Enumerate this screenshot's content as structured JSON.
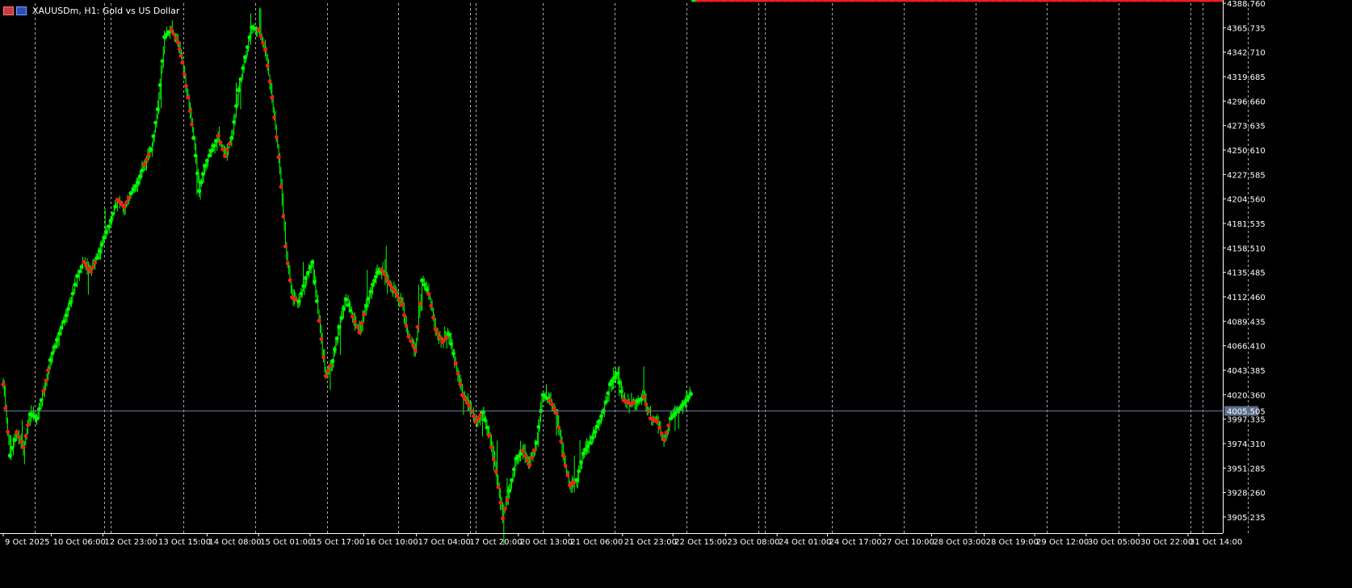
{
  "window": {
    "title": "XAUUSDm, H1:  Gold vs US Dollar",
    "icons": [
      "chart-type-icon",
      "timeframe-icon"
    ]
  },
  "colors": {
    "background": "#000000",
    "bull_candle": "#00ff00",
    "marker_up": "#00ff00",
    "marker_down": "#ff1a1a",
    "grid": "#c8c8c8",
    "axis_text": "#ffffff",
    "current_price_line": "#6a7d95",
    "current_price_label_bg": "#5a6e88"
  },
  "chart_data": {
    "type": "line",
    "symbol": "XAUUSDm",
    "timeframe": "H1",
    "description": "Gold vs US Dollar",
    "current_price": 4005.505,
    "current_price_label": "4005.505",
    "ylim": [
      3890.0,
      4388.76
    ],
    "y_ticks": [
      4388.76,
      4365.735,
      4342.71,
      4319.685,
      4296.66,
      4273.635,
      4250.61,
      4227.585,
      4204.56,
      4181.535,
      4158.51,
      4135.485,
      4112.46,
      4089.435,
      4066.41,
      4043.385,
      4020.36,
      3997.335,
      3974.31,
      3951.285,
      3928.26,
      3905.235
    ],
    "y_tick_labels": [
      "4388.760",
      "4365.735",
      "4342.710",
      "4319.685",
      "4296.660",
      "4273.635",
      "4250.610",
      "4227.585",
      "4204.560",
      "4181.535",
      "4158.510",
      "4135.485",
      "4112.460",
      "4089.435",
      "4066.410",
      "4043.385",
      "4020.360",
      "3997.335",
      "3974.310",
      "3951.285",
      "3928.260",
      "3905.235"
    ],
    "x_labels": [
      "9 Oct 2025",
      "10 Oct 06:00",
      "12 Oct 23:00",
      "13 Oct 15:00",
      "14 Oct 08:00",
      "15 Oct 01:00",
      "15 Oct 17:00",
      "16 Oct 10:00",
      "17 Oct 04:00",
      "17 Oct 20:00",
      "20 Oct 13:00",
      "21 Oct 06:00",
      "21 Oct 23:00",
      "22 Oct 15:00",
      "23 Oct 08:00",
      "24 Oct 01:00",
      "24 Oct 17:00",
      "27 Oct 10:00",
      "28 Oct 03:00",
      "28 Oct 19:00",
      "29 Oct 12:00",
      "30 Oct 05:00",
      "30 Oct 22:00",
      "31 Oct 14:00"
    ],
    "x_label_bars": [
      0,
      43,
      89,
      137,
      182,
      228,
      274,
      322,
      369,
      415,
      460,
      505,
      553,
      598,
      645,
      691,
      736,
      783,
      829,
      876,
      921,
      967,
      1014,
      1058
    ],
    "bar_count": 1089,
    "day_separators": [
      28,
      90,
      96,
      161,
      225,
      289,
      353,
      417,
      422,
      482,
      546,
      610,
      674,
      680,
      740,
      804,
      868,
      932,
      996,
      1060,
      1071,
      1111
    ],
    "series": [
      {
        "bars": [
          0,
          6,
          12,
          18,
          24,
          30,
          36,
          42,
          48,
          54,
          60,
          66,
          72,
          78,
          84,
          90,
          96,
          102,
          108,
          114,
          120,
          126,
          132,
          138,
          144,
          150,
          156,
          160,
          165,
          170,
          175,
          180,
          186,
          192,
          198,
          204,
          210,
          216,
          222,
          228,
          234,
          240,
          246,
          252,
          258,
          264,
          270,
          276,
          282,
          288,
          294,
          300,
          306,
          312,
          318,
          324,
          330,
          334,
          338,
          344,
          350,
          356,
          362,
          368,
          374,
          380,
          386,
          392,
          398,
          404,
          410,
          416,
          422,
          428,
          434,
          440,
          446,
          452,
          458,
          464,
          470,
          476,
          482,
          488,
          494,
          500,
          506,
          512,
          518,
          524,
          530,
          536,
          542,
          548,
          554,
          560,
          566,
          572,
          578,
          584,
          590,
          596,
          602,
          608,
          614,
          620,
          626,
          632,
          638,
          644,
          650,
          656,
          662,
          668,
          674,
          680,
          686,
          692,
          698,
          704,
          710,
          716,
          722,
          728,
          734,
          740,
          746,
          752,
          758,
          764,
          770,
          776,
          782,
          788,
          794,
          800,
          806,
          812,
          818,
          824,
          830,
          836,
          842,
          848,
          854,
          860,
          866,
          872,
          878,
          884,
          890,
          896,
          902,
          908,
          914,
          920,
          926,
          932,
          938,
          944,
          950,
          956,
          962,
          968,
          974,
          980,
          986,
          992,
          998,
          1004,
          1010,
          1016,
          1022,
          1028,
          1034,
          1040,
          1046,
          1052,
          1058,
          1064,
          1070,
          1076,
          1082,
          1088
        ],
        "close": [
          4030,
          3963,
          3985,
          3971,
          4002,
          3998,
          4024,
          4053,
          4072,
          4089,
          4107,
          4132,
          4145,
          4136,
          4149,
          4168,
          4184,
          4204,
          4197,
          4210,
          4220,
          4237,
          4251,
          4289,
          4357,
          4364,
          4352,
          4333,
          4300,
          4262,
          4212,
          4236,
          4250,
          4264,
          4245,
          4262,
          4307,
          4338,
          4366,
          4364,
          4345,
          4300,
          4244,
          4160,
          4112,
          4108,
          4130,
          4145,
          4090,
          4038,
          4052,
          4084,
          4110,
          4094,
          4079,
          4104,
          4124,
          4135,
          4138,
          4126,
          4117,
          4105,
          4075,
          4062,
          4128,
          4115,
          4082,
          4070,
          4077,
          4050,
          4020,
          4010,
          3995,
          4004,
          3982,
          3948,
          3904,
          3930,
          3960,
          3967,
          3954,
          3975,
          4020,
          4015,
          4003,
          3963,
          3935,
          3940,
          3965,
          3975,
          3990,
          4005,
          4030,
          4040,
          4015,
          4012,
          4014,
          4018,
          3998,
          3995,
          3978,
          3998,
          4005,
          4012,
          4021
        ],
        "markers_up": [
          0,
          1,
          0,
          0,
          1,
          1,
          0,
          1,
          1,
          1,
          1,
          1,
          0,
          0,
          1,
          1,
          1,
          0,
          0,
          1,
          1,
          0,
          1,
          1,
          1,
          0,
          0,
          0,
          0,
          1,
          1,
          1,
          1,
          0,
          0,
          1,
          1,
          1,
          1,
          0,
          0,
          0,
          0,
          0,
          0,
          1,
          1,
          1,
          0,
          0,
          1,
          1,
          1,
          0,
          0,
          1,
          1,
          1,
          0,
          0,
          0,
          0,
          0,
          0,
          1,
          0,
          0,
          0,
          1,
          0,
          0,
          0,
          0,
          1,
          0,
          0,
          0,
          1,
          1,
          0,
          0,
          1,
          1,
          0,
          0,
          0,
          0,
          1,
          1,
          1,
          1,
          1,
          1,
          1,
          0,
          0,
          1,
          0,
          0,
          0,
          0,
          1,
          1,
          1,
          1
        ]
      }
    ],
    "grid": "vertical-dashed",
    "legend": "none"
  }
}
